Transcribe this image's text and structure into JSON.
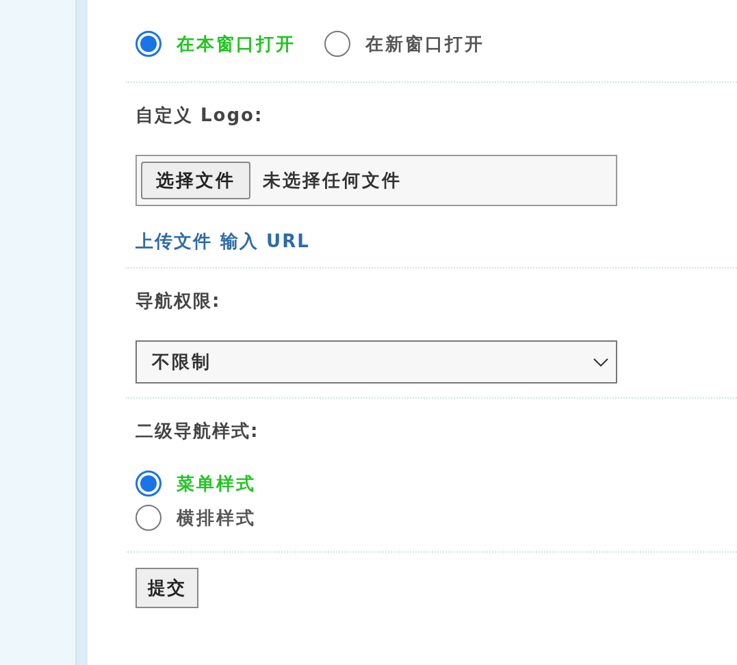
{
  "open_mode": {
    "options": [
      {
        "label": "在本窗口打开",
        "selected": true
      },
      {
        "label": "在新窗口打开",
        "selected": false
      }
    ]
  },
  "logo": {
    "label": "自定义 Logo:",
    "file_button": "选择文件",
    "file_status": "未选择任何文件",
    "links": [
      "上传文件",
      "输入 URL"
    ]
  },
  "permission": {
    "label": "导航权限:",
    "value": "不限制"
  },
  "submenu_style": {
    "label": "二级导航样式:",
    "options": [
      {
        "label": "菜单样式",
        "selected": true
      },
      {
        "label": "横排样式",
        "selected": false
      }
    ]
  },
  "submit": "提交"
}
